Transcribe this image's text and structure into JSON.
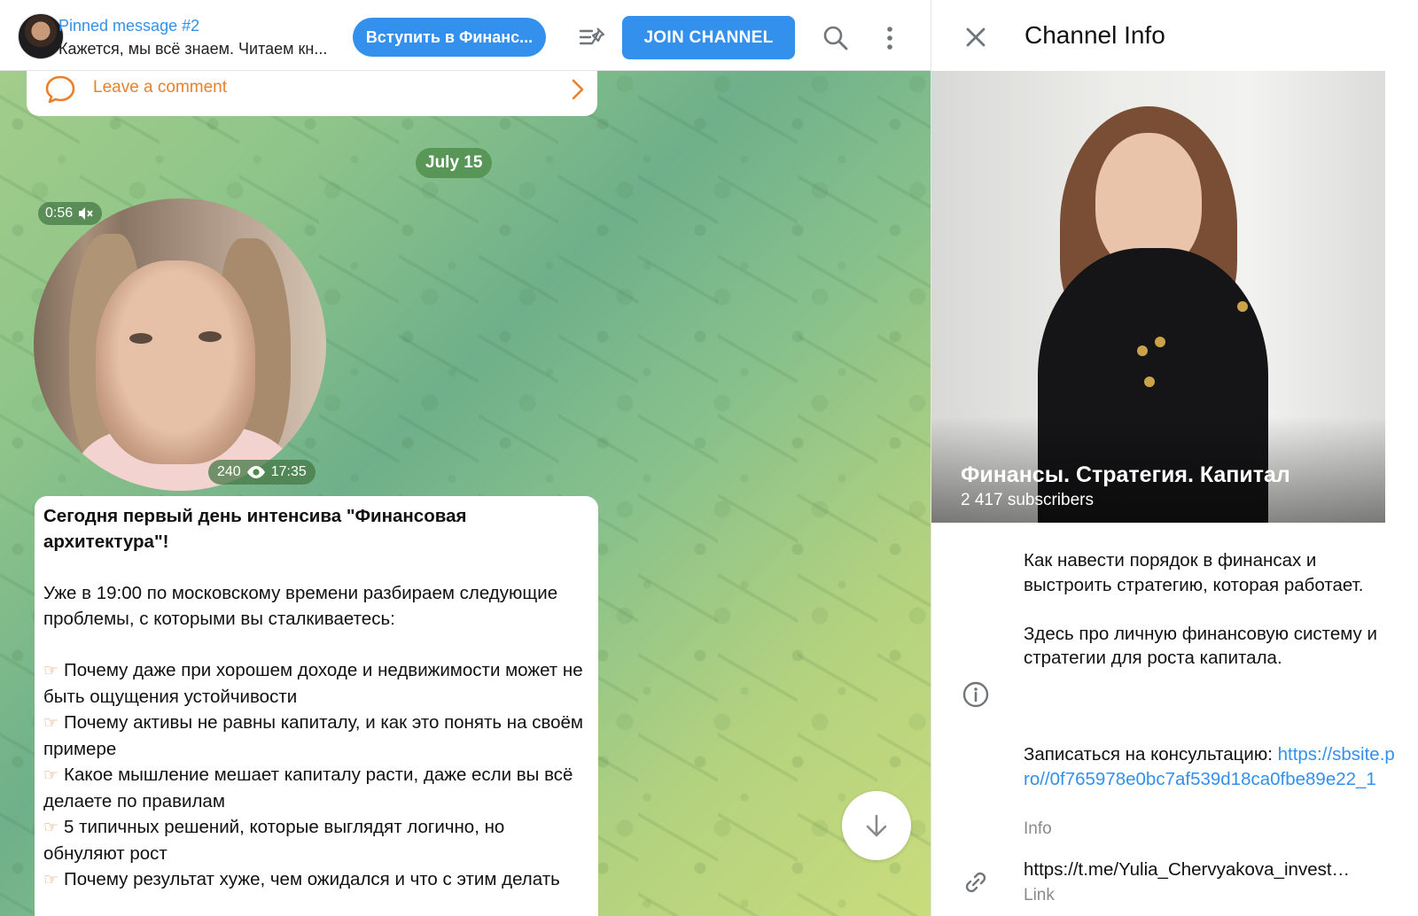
{
  "topbar": {
    "pinned_title": "Pinned message #2",
    "pinned_text": "Кажется, мы всё знаем. Читаем кн...",
    "join_finance_button": "Вступить в Финанс...",
    "join_channel_button": "JOIN CHANNEL"
  },
  "chat": {
    "comment_label": "Leave a comment",
    "date_chip": "July 15",
    "video": {
      "duration": "0:56",
      "views": "240",
      "time": "17:35"
    },
    "message": {
      "headline": "Сегодня первый день интенсива \"Финансовая архитектура\"!",
      "intro": "Уже в 19:00 по московскому времени разбираем следующие проблемы, с которыми вы сталкиваетесь:",
      "bullets": [
        "Почему даже при хорошем доходе и недвижимости может не быть ощущения устойчивости",
        "Почему активы не равны капиталу, и как это понять на своём примере",
        "Какое мышление мешает капиталу расти, даже если вы всё делаете по правилам",
        "5 типичных решений, которые выглядят логично, но обнуляют рост",
        "Почему результат хуже, чем ожидался и что с этим делать"
      ]
    }
  },
  "info": {
    "title": "Channel Info",
    "channel_name": "Финансы. Стратегия. Капитал",
    "subscribers": "2 417 subscribers",
    "description_1": "Как навести порядок в финансах и выстроить стратегию, которая работает.",
    "description_2": "Здесь про личную финансовую систему и стратегии для роста капитала.",
    "consult_prefix": "Записаться на консультацию: ",
    "consult_link": "https://sbsite.pro//0f765978e0bc7af539d18ca0fbe89e22_1",
    "info_label": "Info",
    "channel_link": "https://t.me/Yulia_Chervyakova_investment",
    "link_label": "Link"
  },
  "icons": {
    "comment": "comment-bubble-icon",
    "arrow": "chevron-right-icon",
    "unpin": "unpin-list-icon",
    "search": "search-icon",
    "more": "more-vertical-icon",
    "close": "close-icon",
    "info": "info-icon",
    "link": "link-icon",
    "scroll": "arrow-down-icon",
    "muted": "speaker-muted-icon",
    "views": "eye-icon"
  },
  "colors": {
    "accent": "#3390ec",
    "comment": "#e8802c",
    "chip": "#4c8c48"
  }
}
